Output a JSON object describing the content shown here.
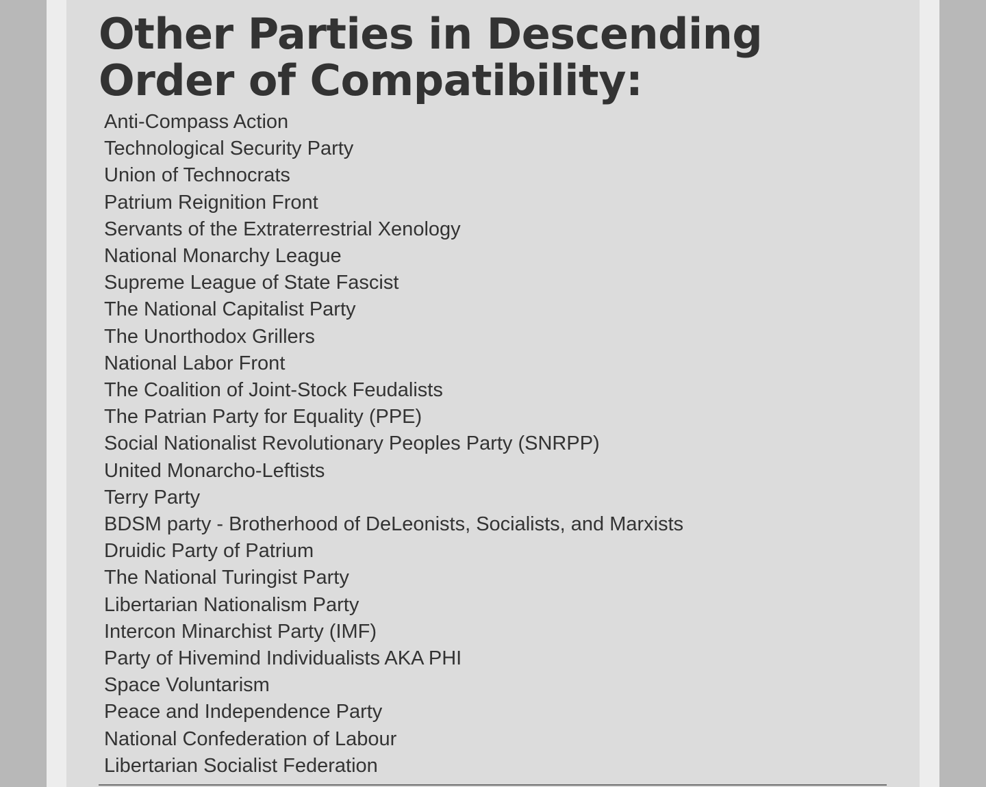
{
  "heading": {
    "line1": "Other Parties in Descending",
    "line2": "Order of Compatibility:"
  },
  "parties": [
    "Anti-Compass Action",
    "Technological Security Party",
    "Union of Technocrats",
    "Patrium Reignition Front",
    "Servants of the Extraterrestrial Xenology",
    "National Monarchy League",
    "Supreme League of State Fascist",
    "The National Capitalist Party",
    "The Unorthodox Grillers",
    "National Labor Front",
    "The Coalition of Joint-Stock Feudalists",
    "The Patrian Party for Equality (PPE)",
    "Social Nationalist Revolutionary Peoples Party (SNRPP)",
    "United Monarcho-Leftists",
    "Terry Party",
    "BDSM party - Brotherhood of DeLeonists, Socialists, and Marxists",
    "Druidic Party of Patrium",
    "The National Turingist Party",
    "Libertarian Nationalism Party",
    "Intercon Minarchist Party (IMF)",
    "Party of Hivemind Individualists AKA PHI",
    "Space Voluntarism",
    "Peace and Independence Party",
    "National Confederation of Labour",
    "Libertarian Socialist Federation"
  ],
  "colors": {
    "text": "#333333",
    "card_background": "#dcdcdc",
    "page_background": "#b8b8b8"
  }
}
